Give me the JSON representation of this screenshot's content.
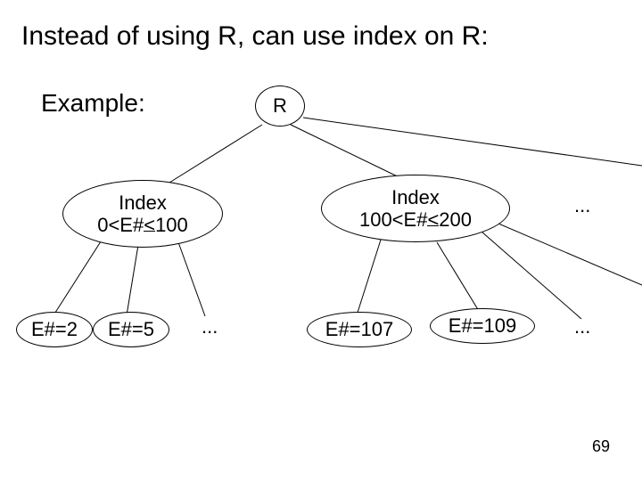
{
  "title": "Instead of using R, can use index on R:",
  "example_label": "Example:",
  "root_label": "R",
  "idx_left_line1": "Index",
  "idx_left_line2_a": "0<E#",
  "idx_left_line2_b": "<",
  "idx_left_line2_c": "100",
  "idx_right_line1": "Index",
  "idx_right_line2_a": "100<E#",
  "idx_right_line2_b": "<",
  "idx_right_line2_c": "200",
  "leaf1": "E#=2",
  "leaf2": "E#=5",
  "leaf3": "E#=107",
  "leaf4": "E#=109",
  "dots": "...",
  "slide_number": "69"
}
